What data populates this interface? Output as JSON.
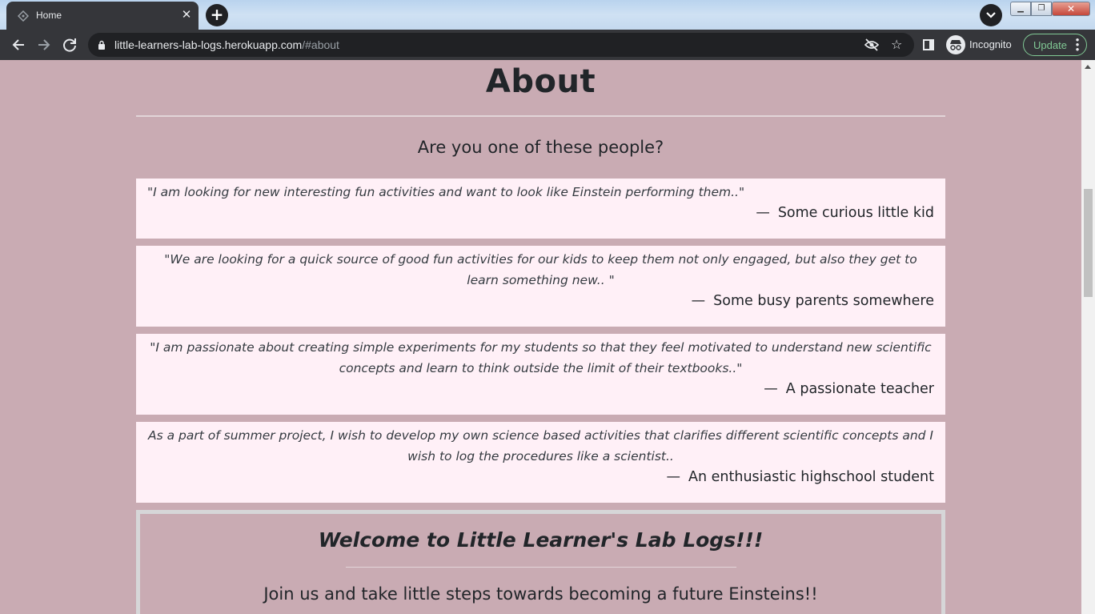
{
  "browser": {
    "tab_title": "Home",
    "url_host": "little-learners-lab-logs.herokuapp.com",
    "url_path": "/#about",
    "profile_label": "Incognito",
    "update_label": "Update",
    "icons": [
      "tab-favicon-icon",
      "close-icon",
      "plus-icon",
      "chevron-down-icon",
      "back-arrow-icon",
      "forward-arrow-icon",
      "reload-icon",
      "lock-icon",
      "eye-off-icon",
      "star-icon",
      "side-panel-icon",
      "incognito-icon",
      "kebab-menu-icon"
    ]
  },
  "page": {
    "about_heading": "About",
    "question": "Are you one of these people?",
    "quotes": [
      {
        "text": "\"I am looking for new interesting fun activities and want to look like Einstein performing them..\"",
        "author": "Some curious little kid"
      },
      {
        "text": "\"We are looking for a quick source of good fun activities for our kids to keep them not only engaged, but also they get to learn something new.. \"",
        "author": "Some busy parents somewhere"
      },
      {
        "text": "\"I am passionate about creating simple experiments for my students so that they feel motivated to understand new scientific concepts and learn to think outside the limit of their textbooks..\"",
        "author": "A passionate teacher"
      },
      {
        "text": "As a part of summer project, I wish to develop my own science based activities that clarifies different scientific concepts and I wish to log the procedures like a scientist..",
        "author": "An enthusiastic highschool student"
      }
    ],
    "dash": "—",
    "welcome_title": "Welcome to Little Learner's Lab Logs!!!",
    "welcome_subtitle": "Join us and take little steps towards becoming a future Einsteins!!"
  },
  "colors": {
    "page_background": "#c9abb3",
    "quote_card_background": "#fff0f7",
    "text": "#212529",
    "update_accent": "#81c995"
  }
}
